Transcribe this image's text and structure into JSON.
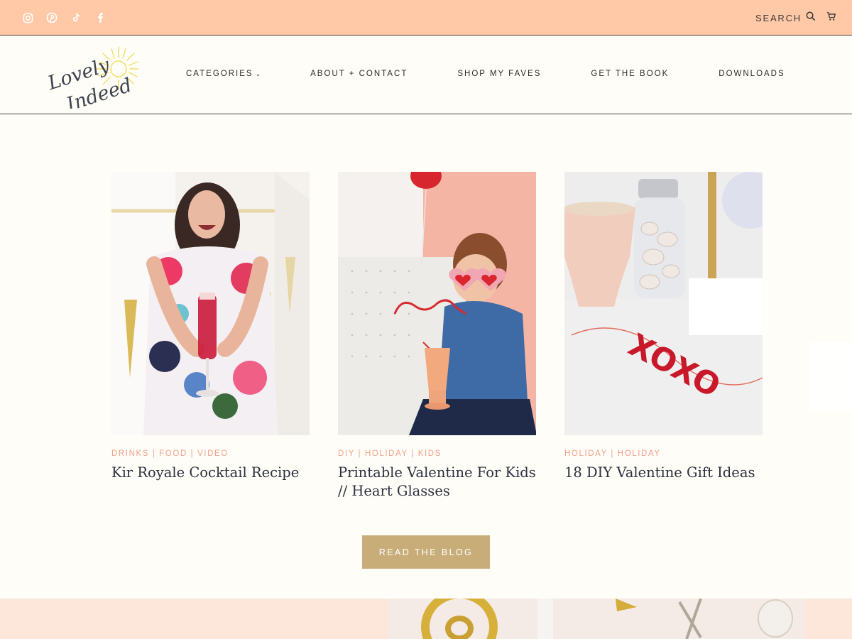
{
  "topbar": {
    "social_icons": [
      "instagram-icon",
      "pinterest-icon",
      "tiktok-icon",
      "facebook-icon"
    ],
    "search_label": "SEARCH",
    "cart_icon": "cart-icon"
  },
  "header": {
    "logo": {
      "line1": "Lovely",
      "line2": "Indeed"
    },
    "nav": [
      {
        "label": "CATEGORIES",
        "has_dropdown": true
      },
      {
        "label": "ABOUT + CONTACT"
      },
      {
        "label": "SHOP MY FAVES"
      },
      {
        "label": "GET THE BOOK"
      },
      {
        "label": "DOWNLOADS"
      }
    ]
  },
  "posts": [
    {
      "categories": "DRINKS | FOOD | VIDEO",
      "title": "Kir Royale Cocktail Recipe"
    },
    {
      "categories": "DIY | HOLIDAY | KIDS",
      "title": "Printable Valentine For Kids // Heart Glasses"
    },
    {
      "categories": "HOLIDAY | HOLIDAY",
      "title": "18 DIY Valentine Gift Ideas"
    }
  ],
  "cta": {
    "label": "READ THE BLOG"
  },
  "colors": {
    "topbar_bg": "#ffc8a6",
    "page_bg": "#fffdf7",
    "accent_pink": "#f2a18c",
    "button_gold": "#c9ad79",
    "title_navy": "#2c3140"
  }
}
